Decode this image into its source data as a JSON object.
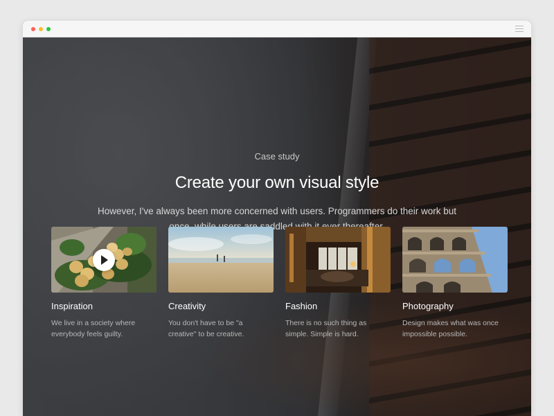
{
  "hero": {
    "eyebrow": "Case study",
    "headline": "Create your own visual style",
    "lead": "However, I've always been more concerned with users. Programmers do their work but once, while users are saddled with it ever thereafter."
  },
  "cards": [
    {
      "title": "Inspiration",
      "description": "We live in a society where everybody feels guilty.",
      "has_play_button": true
    },
    {
      "title": "Creativity",
      "description": "You don't have to be \"a creative\" to be creative."
    },
    {
      "title": "Fashion",
      "description": "There is no such thing as simple. Simple is hard."
    },
    {
      "title": "Photography",
      "description": "Design makes what was once impossible possible."
    }
  ],
  "colors": {
    "window_close": "#ff5f57",
    "window_minimize": "#febc2e",
    "window_maximize": "#28c840"
  },
  "icons": [
    "close-dot-icon",
    "minimize-dot-icon",
    "maximize-dot-icon",
    "hamburger-menu-icon",
    "play-icon"
  ]
}
